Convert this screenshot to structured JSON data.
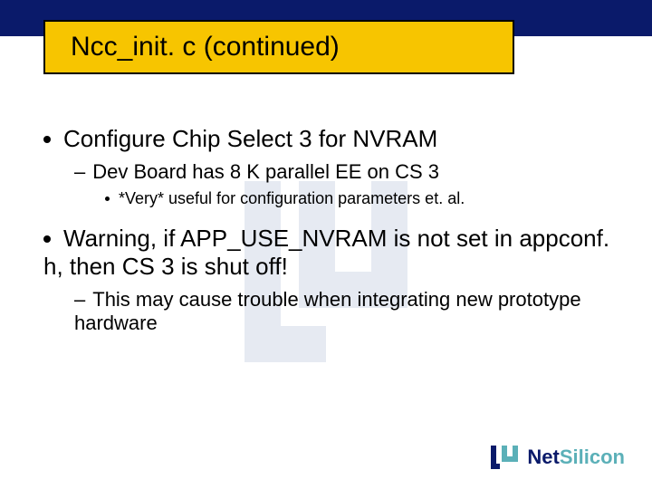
{
  "title": "Ncc_init. c (continued)",
  "bullets": {
    "b1a": "Configure Chip Select 3 for NVRAM",
    "b2a": "Dev Board has 8 K parallel EE on CS 3",
    "b3a": "*Very* useful for configuration parameters et. al.",
    "b1b": "Warning, if APP_USE_NVRAM is not set in appconf. h, then CS 3 is shut off!",
    "b2b": "This may cause trouble when integrating new prototype hardware"
  },
  "logo": {
    "net": "Net",
    "silicon": "Silicon"
  }
}
